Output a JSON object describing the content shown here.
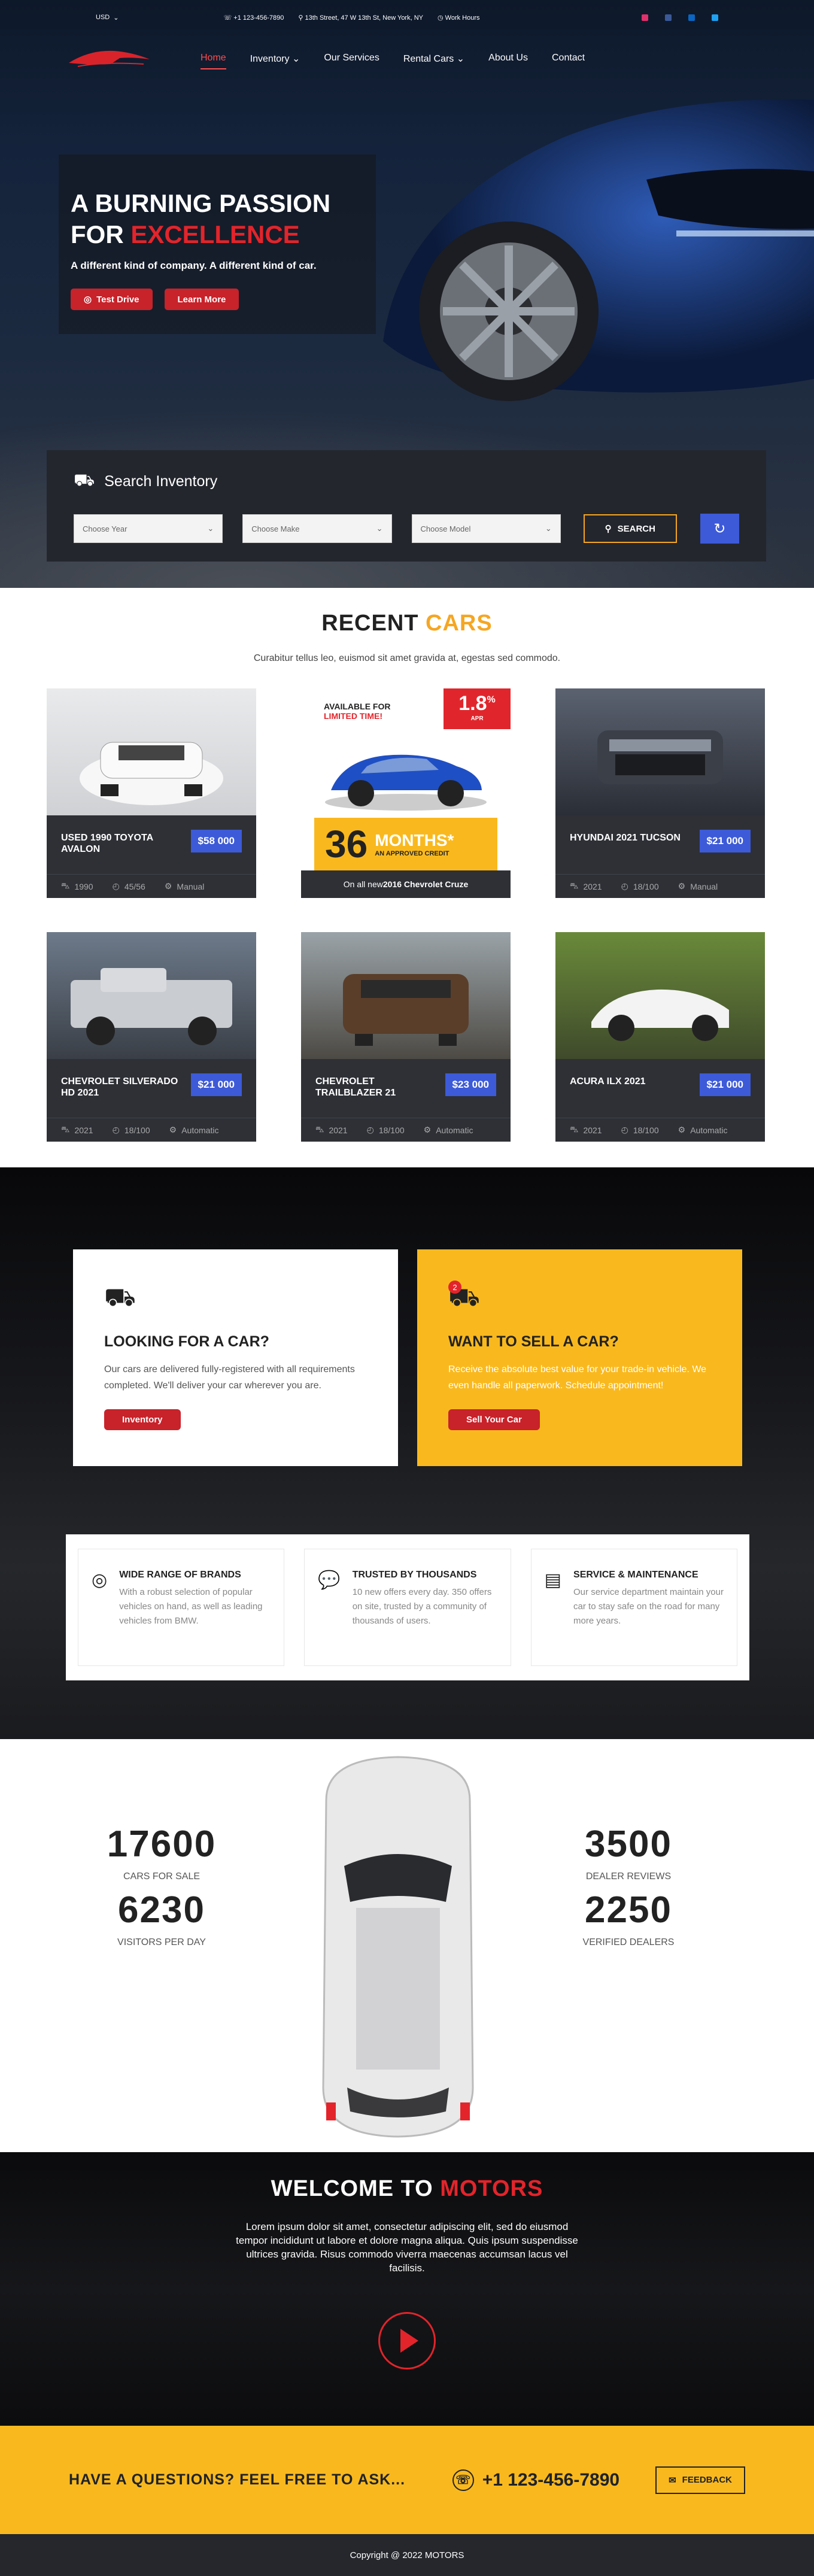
{
  "topbar": {
    "currency": "USD",
    "phone": "+1 123-456-7890",
    "address": "13th Street, 47 W 13th St, New York, NY",
    "hours": "Work Hours"
  },
  "nav": {
    "items": [
      {
        "label": "Home"
      },
      {
        "label": "Inventory"
      },
      {
        "label": "Our Services"
      },
      {
        "label": "Rental Cars"
      },
      {
        "label": "About Us"
      },
      {
        "label": "Contact"
      }
    ]
  },
  "hero": {
    "title1": "A BURNING PASSION",
    "title2a": "FOR ",
    "title2b": "EXCELLENCE",
    "subtitle": "A different kind of company. A different kind of car.",
    "btn_test": "Test Drive",
    "btn_learn": "Learn More"
  },
  "search": {
    "title": "Search Inventory",
    "year": "Choose Year",
    "make": "Choose Make",
    "model": "Choose Model",
    "button": "SEARCH"
  },
  "recent": {
    "title_a": "RECENT ",
    "title_b": "CARS",
    "subtitle": "Curabitur tellus leo, euismod sit amet gravida at, egestas sed commodo."
  },
  "cars": [
    {
      "title": "USED 1990 TOYOTA AVALON",
      "price": "$58 000",
      "year": "1990",
      "miles": "45/56",
      "trans": "Manual"
    },
    {
      "title": "HYUNDAI 2021 TUCSON",
      "price": "$21 000",
      "year": "2021",
      "miles": "18/100",
      "trans": "Manual"
    },
    {
      "title": "CHEVROLET SILVERADO HD 2021",
      "price": "$21 000",
      "year": "2021",
      "miles": "18/100",
      "trans": "Automatic"
    },
    {
      "title": "CHEVROLET TRAILBLAZER 21",
      "price": "$23 000",
      "year": "2021",
      "miles": "18/100",
      "trans": "Automatic"
    },
    {
      "title": "ACURA ILX 2021",
      "price": "$21 000",
      "year": "2021",
      "miles": "18/100",
      "trans": "Automatic"
    }
  ],
  "promo": {
    "available": "AVAILABLE FOR",
    "limited": "LIMITED TIME!",
    "rate": "1.8",
    "pct": "%",
    "apr": "APR",
    "months_num": "36",
    "months": "MONTHS*",
    "approved": "AN APPROVED CREDIT",
    "note_a": "On all new ",
    "note_b": "2016 Chevrolet Cruze"
  },
  "looking": {
    "title": "LOOKING FOR A CAR?",
    "text": "Our cars are delivered fully-registered with all requirements completed. We'll deliver your car wherever you are.",
    "button": "Inventory"
  },
  "sell": {
    "title": "WANT TO SELL A CAR?",
    "text": "Receive the absolute best value for your trade-in vehicle. We even handle all paperwork. Schedule appointment!",
    "button": "Sell Your Car",
    "badge": "2"
  },
  "features": [
    {
      "title": "WIDE RANGE OF BRANDS",
      "text": "With a robust selection of popular vehicles on hand, as well as leading vehicles from BMW."
    },
    {
      "title": "TRUSTED BY THOUSANDS",
      "text": "10 new offers every day. 350 offers on site, trusted by a community of thousands of users."
    },
    {
      "title": "SERVICE & MAINTENANCE",
      "text": "Our service department maintain your car to stay safe on the road for many more years."
    }
  ],
  "stats": [
    {
      "value": "17600",
      "label": "CARS FOR SALE"
    },
    {
      "value": "6230",
      "label": "VISITORS PER DAY"
    },
    {
      "value": "3500",
      "label": "DEALER REVIEWS"
    },
    {
      "value": "2250",
      "label": "VERIFIED DEALERS"
    }
  ],
  "welcome": {
    "title_a": "WELCOME TO ",
    "title_b": "MOTORS",
    "text": "Lorem ipsum dolor sit amet, consectetur adipiscing elit, sed do eiusmod tempor incididunt ut labore et dolore magna aliqua. Quis ipsum suspendisse ultrices gravida. Risus commodo viverra maecenas accumsan lacus vel facilisis."
  },
  "cta": {
    "question": "HAVE A QUESTIONS? FEEL FREE TO ASK...",
    "phone": "+1 123-456-7890",
    "feedback": "FEEDBACK"
  },
  "footer": {
    "copyright": "Copyright @ 2022 MOTORS"
  },
  "colors": {
    "accent_red": "#e3242b",
    "accent_yellow": "#f9b91e",
    "price_blue": "#3d5ad8"
  }
}
